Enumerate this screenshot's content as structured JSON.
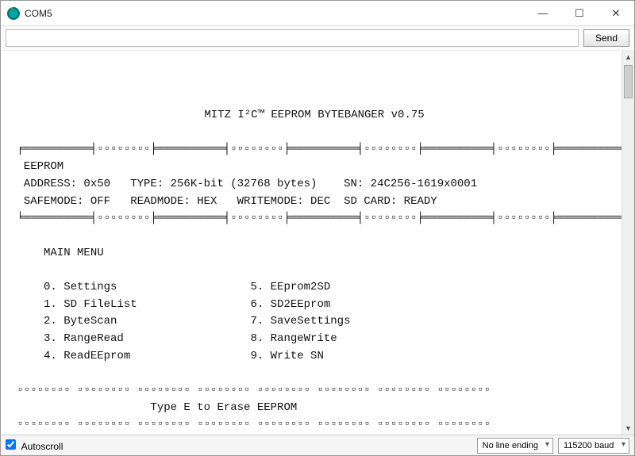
{
  "window": {
    "title": "COM5",
    "send_label": "Send",
    "input_value": ""
  },
  "console": {
    "blank": " ",
    "app_title": "MITZ I²C™ EEPROM BYTEBANGER v0.75",
    "rule_top": " ╒══════════╡▫▫▫▫▫▫▫▫╞══════════╡▫▫▫▫▫▫▫▫╞══════════╡▫▫▫▫▫▫▫▫╞══════════╡▫▫▫▫▫▫▫▫╞══════════╕",
    "hdr_eeprom": "  EEPROM",
    "line_addr": "  ADDRESS: 0x50   TYPE: 256K-bit (32768 bytes)    SN: 24C256-1619x0001",
    "line_mode": "  SAFEMODE: OFF   READMODE: HEX   WRITEMODE: DEC  SD CARD: READY",
    "rule_bot": " ╘══════════╡▫▫▫▫▫▫▫▫╞══════════╡▫▫▫▫▫▫▫▫╞══════════╡▫▫▫▫▫▫▫▫╞══════════╡▫▫▫▫▫▫▫▫╞══════════╛",
    "menu_hdr": "     MAIN MENU",
    "m0": "     0. Settings                    5. EEprom2SD",
    "m1": "     1. SD FileList                 6. SD2EEprom",
    "m2": "     2. ByteScan                    7. SaveSettings",
    "m3": "     3. RangeRead                   8. RangeWrite",
    "m4": "     4. ReadEEprom                  9. Write SN",
    "rule_box": " ▫▫▫▫▫▫▫▫ ▫▫▫▫▫▫▫▫ ▫▫▫▫▫▫▫▫ ▫▫▫▫▫▫▫▫ ▫▫▫▫▫▫▫▫ ▫▫▫▫▫▫▫▫ ▫▫▫▫▫▫▫▫ ▫▫▫▫▫▫▫▫",
    "erase": "                     Type E to Erase EEPROM"
  },
  "status": {
    "autoscroll_label": "Autoscroll",
    "autoscroll_checked": true,
    "line_ending": "No line ending",
    "baud": "115200 baud"
  },
  "eeprom": {
    "address": "0x50",
    "type_bits": "256K-bit",
    "type_bytes": 32768,
    "serial": "24C256-1619x0001",
    "safemode": "OFF",
    "readmode": "HEX",
    "writemode": "DEC",
    "sd_card": "READY"
  },
  "menu": {
    "items": [
      {
        "n": 0,
        "label": "Settings"
      },
      {
        "n": 1,
        "label": "SD FileList"
      },
      {
        "n": 2,
        "label": "ByteScan"
      },
      {
        "n": 3,
        "label": "RangeRead"
      },
      {
        "n": 4,
        "label": "ReadEEprom"
      },
      {
        "n": 5,
        "label": "EEprom2SD"
      },
      {
        "n": 6,
        "label": "SD2EEprom"
      },
      {
        "n": 7,
        "label": "SaveSettings"
      },
      {
        "n": 8,
        "label": "RangeWrite"
      },
      {
        "n": 9,
        "label": "Write SN"
      }
    ],
    "erase_hint": "Type E to Erase EEPROM"
  }
}
